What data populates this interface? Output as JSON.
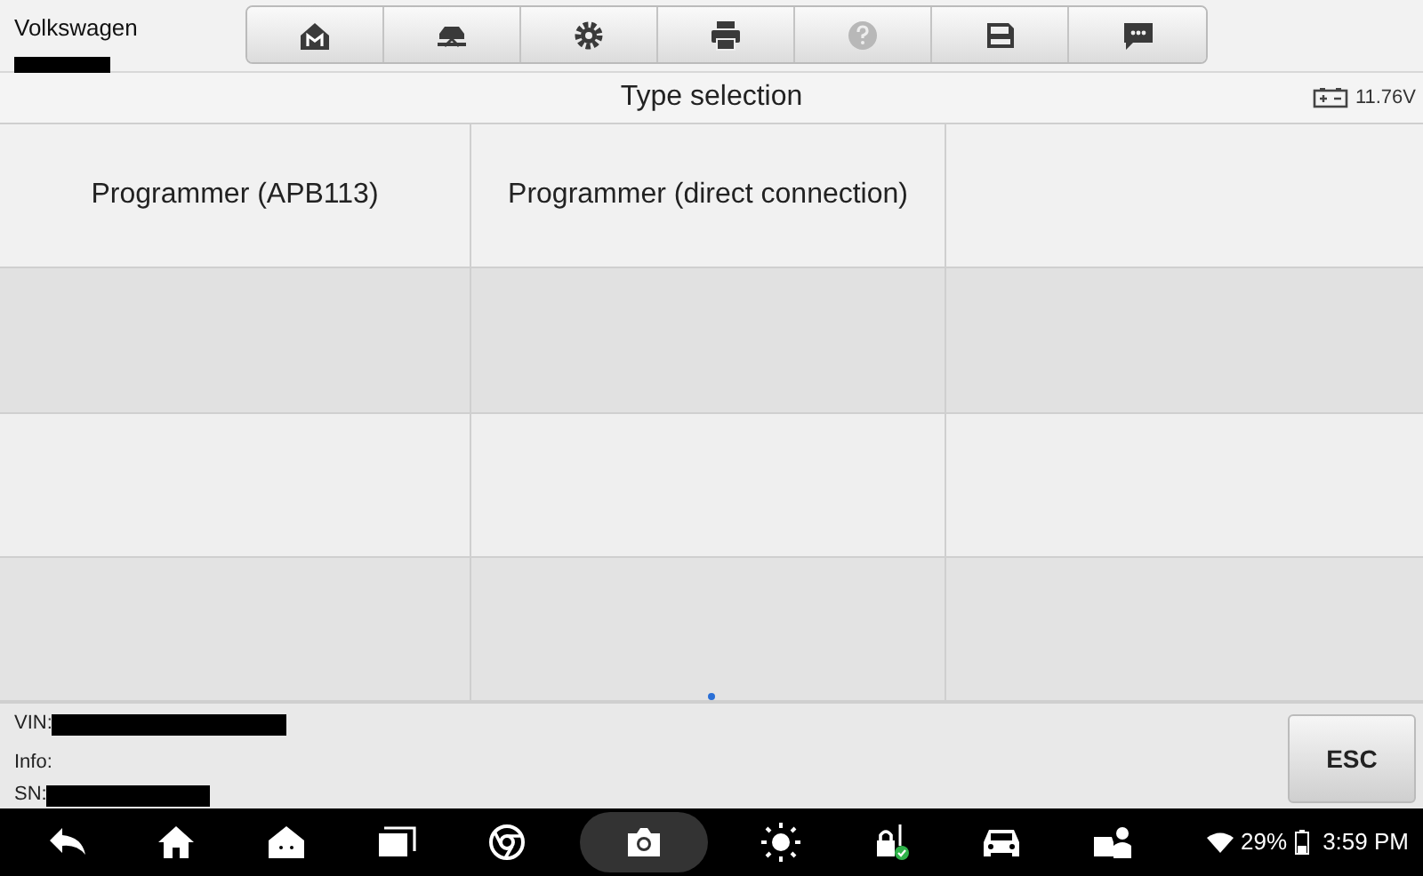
{
  "header": {
    "vehicle": "Volkswagen"
  },
  "toolbar": [
    {
      "disabled": false
    },
    {
      "disabled": false
    },
    {
      "disabled": false
    },
    {
      "disabled": false
    },
    {
      "disabled": true
    },
    {
      "disabled": false
    },
    {
      "disabled": false
    }
  ],
  "title_bar": {
    "title": "Type selection",
    "voltage": "11.76V"
  },
  "options": [
    {
      "label": "Programmer (APB113)"
    },
    {
      "label": "Programmer (direct connection)"
    }
  ],
  "info_panel": {
    "vin_label": "VIN:",
    "info_label": "Info:",
    "sn_label": "SN:",
    "esc_button": "ESC"
  },
  "nav_bar": {
    "buttons": [
      {
        "selected": false
      },
      {
        "selected": false
      },
      {
        "selected": false
      },
      {
        "selected": false
      },
      {
        "selected": false
      },
      {
        "selected": true
      },
      {
        "selected": false
      },
      {
        "selected": false
      },
      {
        "selected": false
      },
      {
        "selected": false
      }
    ],
    "battery": "29%",
    "time": "3:59 PM"
  }
}
